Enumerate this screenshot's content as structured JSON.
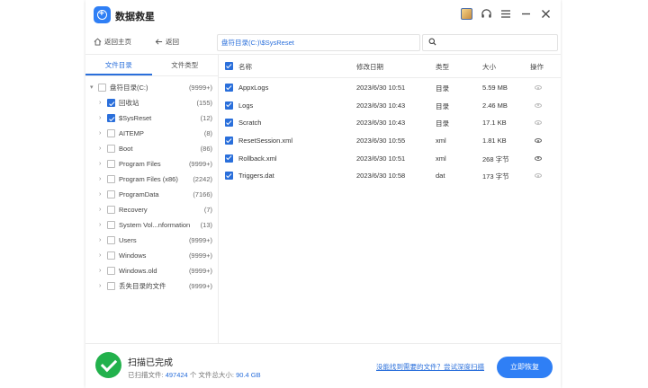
{
  "app": {
    "title": "数据救星"
  },
  "toolbar": {
    "home_label": "返回主页",
    "back_label": "返回",
    "path": "盘符目录(C:)\\$SysReset",
    "search_placeholder": ""
  },
  "left": {
    "tabs": [
      "文件目录",
      "文件类型"
    ],
    "tree": [
      {
        "label": "盘符目录(C:)",
        "count": "(9999+)",
        "checked": false,
        "root": true
      },
      {
        "label": "回收站",
        "count": "(155)",
        "checked": true
      },
      {
        "label": "$SysReset",
        "count": "(12)",
        "checked": true
      },
      {
        "label": "AITEMP",
        "count": "(8)",
        "checked": false
      },
      {
        "label": "Boot",
        "count": "(86)",
        "checked": false
      },
      {
        "label": "Program Files",
        "count": "(9999+)",
        "checked": false
      },
      {
        "label": "Program Files (x86)",
        "count": "(2242)",
        "checked": false
      },
      {
        "label": "ProgramData",
        "count": "(7166)",
        "checked": false
      },
      {
        "label": "Recovery",
        "count": "(7)",
        "checked": false
      },
      {
        "label": "System Vol...nformation",
        "count": "(13)",
        "checked": false
      },
      {
        "label": "Users",
        "count": "(9999+)",
        "checked": false
      },
      {
        "label": "Windows",
        "count": "(9999+)",
        "checked": false
      },
      {
        "label": "Windows.old",
        "count": "(9999+)",
        "checked": false
      },
      {
        "label": "丢失目录的文件",
        "count": "(9999+)",
        "checked": false
      }
    ]
  },
  "table": {
    "headers": {
      "name": "名称",
      "date": "修改日期",
      "type": "类型",
      "size": "大小",
      "action": "操作"
    },
    "rows": [
      {
        "name": "AppxLogs",
        "date": "2023/6/30 10:51",
        "type": "目录",
        "size": "5.59 MB",
        "preview": false
      },
      {
        "name": "Logs",
        "date": "2023/6/30 10:43",
        "type": "目录",
        "size": "2.46 MB",
        "preview": false
      },
      {
        "name": "Scratch",
        "date": "2023/6/30 10:43",
        "type": "目录",
        "size": "17.1 KB",
        "preview": false
      },
      {
        "name": "ResetSession.xml",
        "date": "2023/6/30 10:55",
        "type": "xml",
        "size": "1.81 KB",
        "preview": true
      },
      {
        "name": "Rollback.xml",
        "date": "2023/6/30 10:51",
        "type": "xml",
        "size": "268 字节",
        "preview": true
      },
      {
        "name": "Triggers.dat",
        "date": "2023/6/30 10:58",
        "type": "dat",
        "size": "173 字节",
        "preview": false
      }
    ]
  },
  "footer": {
    "status_title": "扫描已完成",
    "scanned_label": "已扫描文件:",
    "scanned_count": "497424",
    "total_size_label": "个 文件总大小:",
    "total_size": "90.4 GB",
    "deep_scan_link": "没能找到需要的文件？尝试深度扫描",
    "recover_button": "立即恢复"
  },
  "colors": {
    "accent": "#2f7ff5",
    "success": "#22b14c",
    "link": "#2a6fdb"
  }
}
